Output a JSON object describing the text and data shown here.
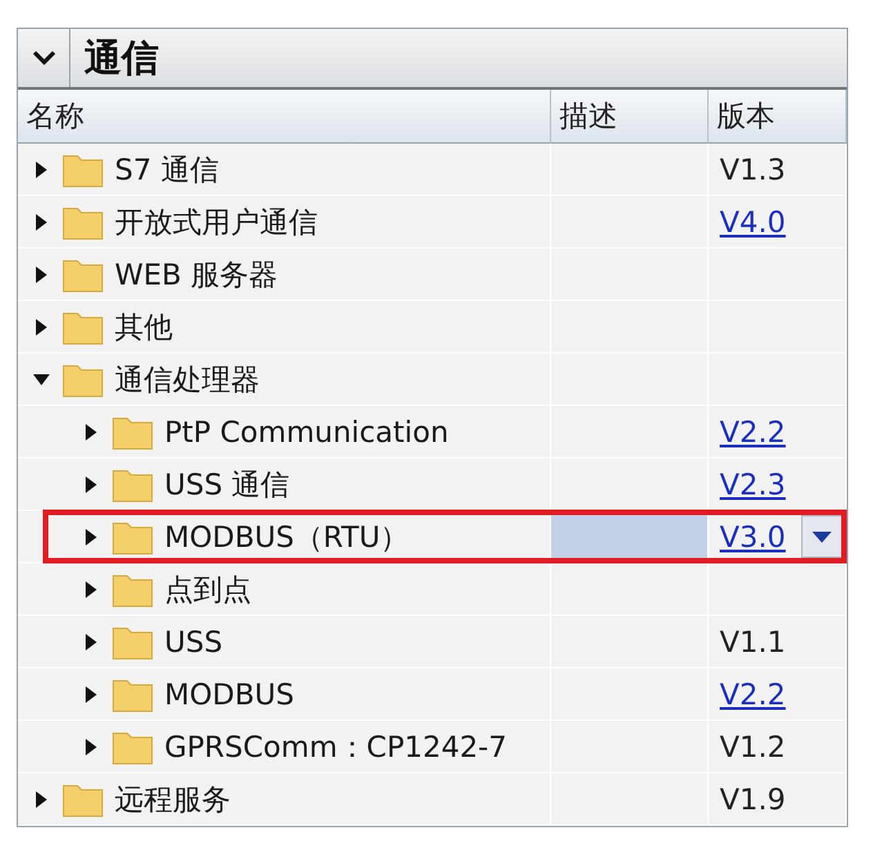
{
  "panel": {
    "title": "通信",
    "expanded": true
  },
  "table": {
    "columns": [
      "名称",
      "描述",
      "版本"
    ],
    "rows": [
      {
        "name": "S7 通信",
        "version": "V1.3",
        "link": false,
        "expanded": false,
        "selected": false
      },
      {
        "name": "开放式用户通信",
        "version": "V4.0",
        "link": true,
        "expanded": false,
        "selected": false
      },
      {
        "name": "WEB 服务器",
        "expanded": false,
        "selected": false
      },
      {
        "name": "其他",
        "expanded": false,
        "selected": false
      },
      {
        "name": "通信处理器",
        "expanded": true,
        "selected": false,
        "children": [
          {
            "name": "PtP Communication",
            "version": "V2.2",
            "link": true,
            "expanded": false,
            "selected": false
          },
          {
            "name": "USS 通信",
            "version": "V2.3",
            "link": true,
            "expanded": false,
            "selected": false
          },
          {
            "name": "MODBUS（RTU）",
            "version": "V3.0",
            "link": true,
            "expanded": false,
            "selected": true
          },
          {
            "name": "点到点",
            "expanded": false,
            "selected": false
          },
          {
            "name": "USS",
            "version": "V1.1",
            "link": false,
            "expanded": false,
            "selected": false
          },
          {
            "name": "MODBUS",
            "version": "V2.2",
            "link": true,
            "expanded": false,
            "selected": false
          },
          {
            "name": "GPRSComm：CP1242-7",
            "version": "V1.2",
            "link": false,
            "expanded": false,
            "selected": false
          }
        ]
      },
      {
        "name": "远程服务",
        "version": "V1.9",
        "link": false,
        "expanded": false,
        "selected": false
      }
    ]
  }
}
